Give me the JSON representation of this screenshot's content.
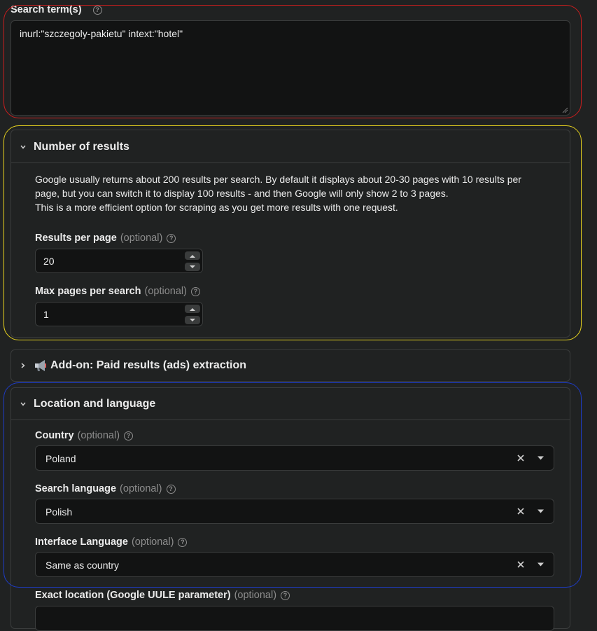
{
  "search": {
    "label": "Search term(s)",
    "value": "inurl:\"szczegoly-pakietu\" intext:\"hotel\""
  },
  "results_section": {
    "title": "Number of results",
    "description_1": "Google usually returns about 200 results per search. By default it displays about 20-30 pages with 10 results per",
    "description_2": "page, but you can switch it to display 100 results - and then Google will only show 2 to 3 pages.",
    "description_3": "This is a more efficient option for scraping as you get more results with one request.",
    "results_per_page": {
      "label": "Results per page",
      "optional": "(optional)",
      "value": "20"
    },
    "max_pages": {
      "label": "Max pages per search",
      "optional": "(optional)",
      "value": "1"
    }
  },
  "addon_section": {
    "title": "Add-on: Paid results (ads) extraction",
    "icon": "megaphone-icon"
  },
  "location_section": {
    "title": "Location and language",
    "country": {
      "label": "Country",
      "optional": "(optional)",
      "value": "Poland"
    },
    "search_language": {
      "label": "Search language",
      "optional": "(optional)",
      "value": "Polish"
    },
    "interface_language": {
      "label": "Interface Language",
      "optional": "(optional)",
      "value": "Same as country"
    },
    "exact_location": {
      "label": "Exact location (Google UULE parameter)",
      "optional": "(optional)"
    }
  },
  "colors": {
    "background": "#202222",
    "field": "#121313",
    "annotation_red": "#c81e1e",
    "annotation_yellow": "#e6d21e",
    "annotation_blue": "#1e3cc8"
  }
}
